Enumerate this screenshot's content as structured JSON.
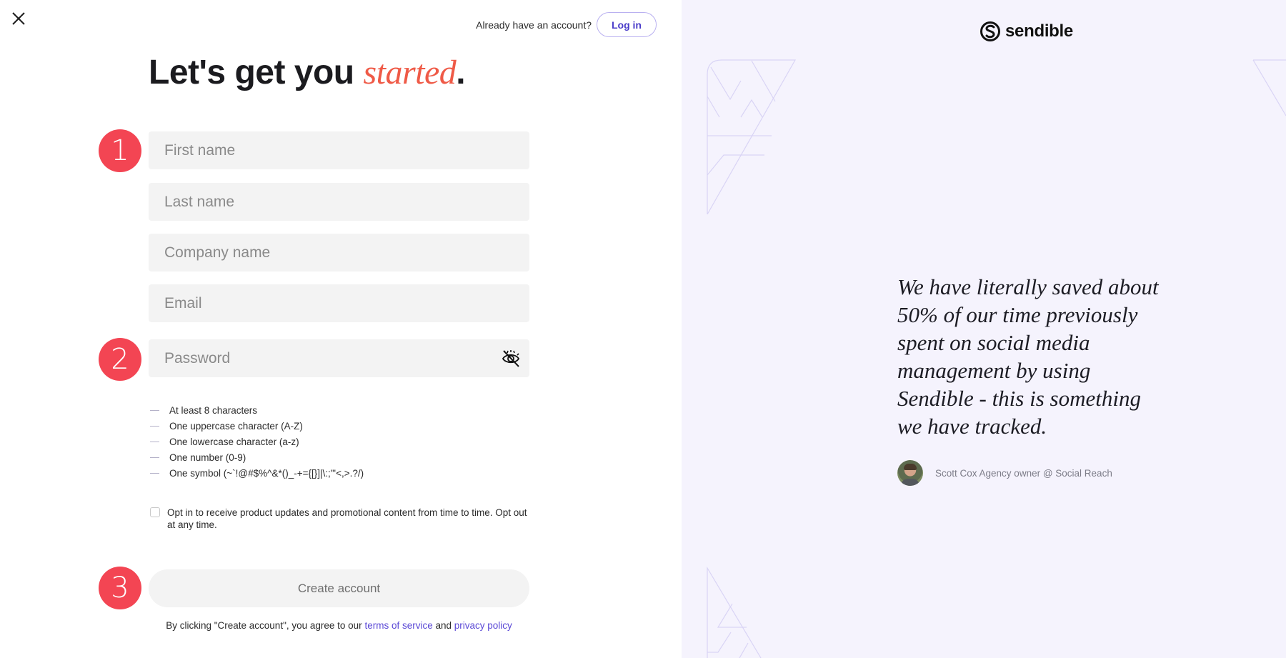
{
  "header": {
    "close_label": "Close",
    "login_prompt": "Already have an account?",
    "login_button": "Log in"
  },
  "heading": {
    "prefix": "Let's get you ",
    "accent": "started",
    "suffix": ".",
    "accent_color": "#ef5a47"
  },
  "steps": [
    "1",
    "2",
    "3"
  ],
  "form": {
    "fields": [
      {
        "name": "first-name",
        "placeholder": "First name",
        "value": ""
      },
      {
        "name": "last-name",
        "placeholder": "Last name",
        "value": ""
      },
      {
        "name": "company-name",
        "placeholder": "Company name",
        "value": ""
      },
      {
        "name": "email",
        "placeholder": "Email",
        "value": ""
      }
    ],
    "password": {
      "placeholder": "Password",
      "value": "",
      "toggle_icon": "eye-slash-icon"
    },
    "requirements": [
      "At least 8 characters",
      "One uppercase character (A-Z)",
      "One lowercase character (a-z)",
      "One number (0-9)",
      "One symbol (~`!@#$%^&*()_-+={[}]|\\:;\"'<,>.?/)"
    ],
    "optin": {
      "checked": false,
      "text": "Opt in to receive product updates and promotional content from time to time. Opt out at any time."
    },
    "submit_label": "Create account",
    "terms": {
      "prefix": "By clicking \"Create account\", you agree to our ",
      "tos_link": "terms of service",
      "middle": " and ",
      "privacy_link": "privacy policy"
    }
  },
  "side": {
    "brand": "sendible",
    "quote": "We have literally saved about 50% of our time previously spent on social media management by using Sendible - this is something we have tracked.",
    "author": "Scott Cox Agency owner @ Social Reach",
    "background_color": "#f5f3fd",
    "step_color": "#f34553",
    "link_color": "#5a48d6"
  }
}
